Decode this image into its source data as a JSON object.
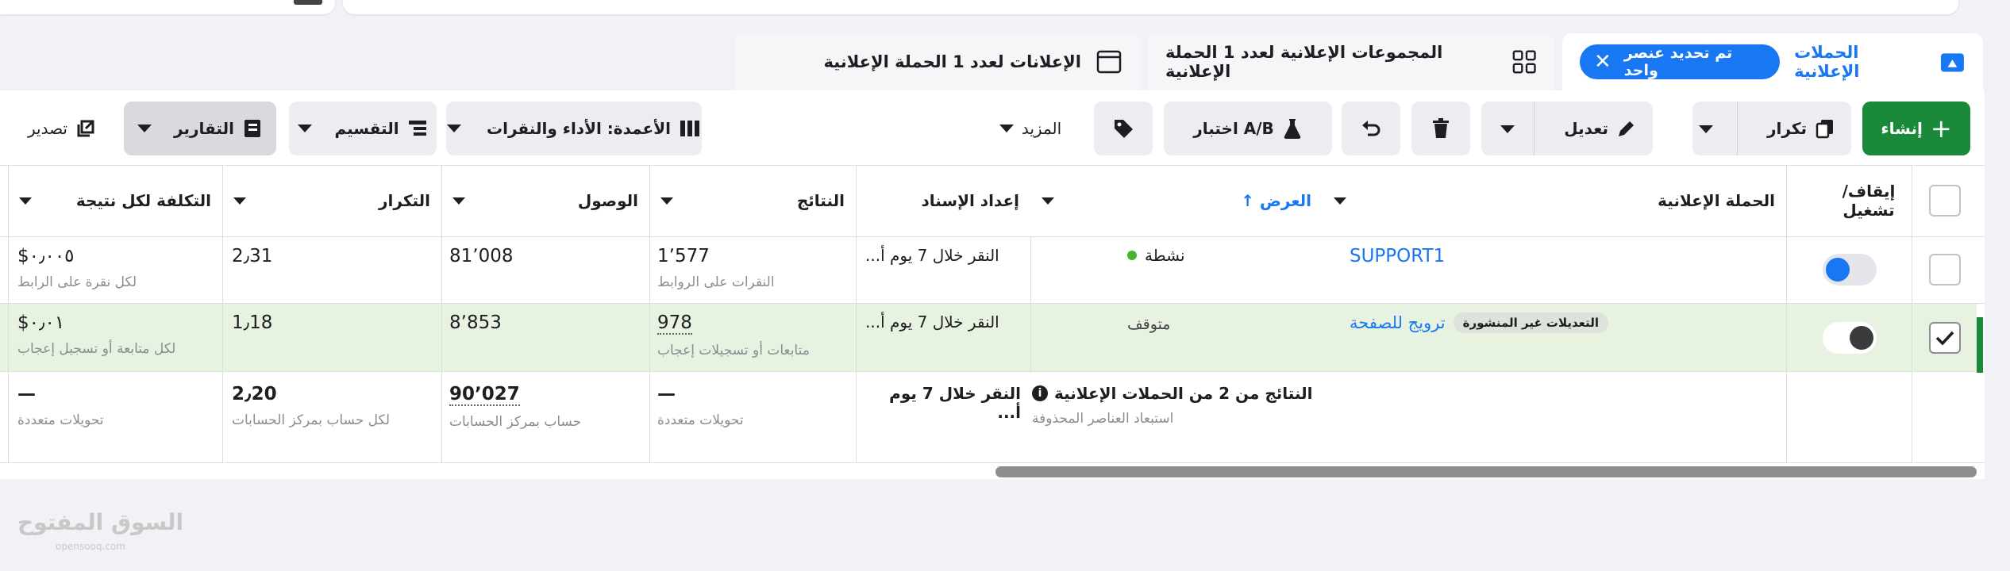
{
  "tabs": {
    "campaigns": {
      "label": "الحملات الإعلانية",
      "selection": "تم تحديد عنصر واحد"
    },
    "adsets": {
      "label": "المجموعات الإعلانية لعدد 1 الحملة الإعلانية"
    },
    "ads": {
      "label": "الإعلانات لعدد 1 الحملة الإعلانية"
    }
  },
  "toolbar": {
    "create": "إنشاء",
    "duplicate": "تكرار",
    "edit": "تعديل",
    "ab_test": "اختبار A/B",
    "more": "المزيد",
    "columns": "الأعمدة: الأداء والنقرات",
    "breakdown": "التقسيم",
    "reports": "التقارير",
    "export": "تصدير"
  },
  "table": {
    "headers": {
      "onoff": "إيقاف/ تشغيل",
      "campaign": "الحملة الإعلانية",
      "delivery": "العرض",
      "attribution": "إعداد الإسناد",
      "results": "النتائج",
      "reach": "الوصول",
      "frequency": "التكرار",
      "cost": "التكلفة لكل نتيجة"
    },
    "rows": [
      {
        "campaign": "SUPPORT1",
        "delivery": "نشطة",
        "attribution": "النقر خلال 7 يوم أ...",
        "results": "1٬577",
        "results_sub": "النقرات على الروابط",
        "reach": "81٬008",
        "frequency": "2٫31",
        "cost": "$٠٫٠٠٥",
        "cost_sub": "لكل نقرة على الرابط"
      },
      {
        "campaign": "ترويج للصفحة",
        "badge": "التعديلات غير المنشورة",
        "delivery": "متوقف",
        "attribution": "النقر خلال 7 يوم أ...",
        "results": "978",
        "results_sub": "متابعات أو تسجيلات إعجاب",
        "reach": "8٬853",
        "frequency": "1٫18",
        "cost": "$٠٫٠١",
        "cost_sub": "لكل متابعة أو تسجيل إعجاب"
      }
    ],
    "summary": {
      "title": "النتائج من 2 من الحملات الإعلانية",
      "sub": "استبعاد العناصر المحذوفة",
      "attribution": "النقر خلال 7 يوم أ...",
      "results": "—",
      "results_sub": "تحويلات متعددة",
      "reach": "90٬027",
      "reach_sub": "حساب بمركز الحسابات",
      "frequency": "2٫20",
      "frequency_sub": "لكل حساب بمركز الحسابات",
      "cost": "—",
      "cost_sub": "تحويلات متعددة"
    }
  },
  "watermark": {
    "main": "السوق المفتوح",
    "sub": "opensooq.com"
  },
  "colors": {
    "accent": "#1877f2",
    "create_green": "#1a8a3a",
    "selected_row": "#e7f3e0"
  }
}
